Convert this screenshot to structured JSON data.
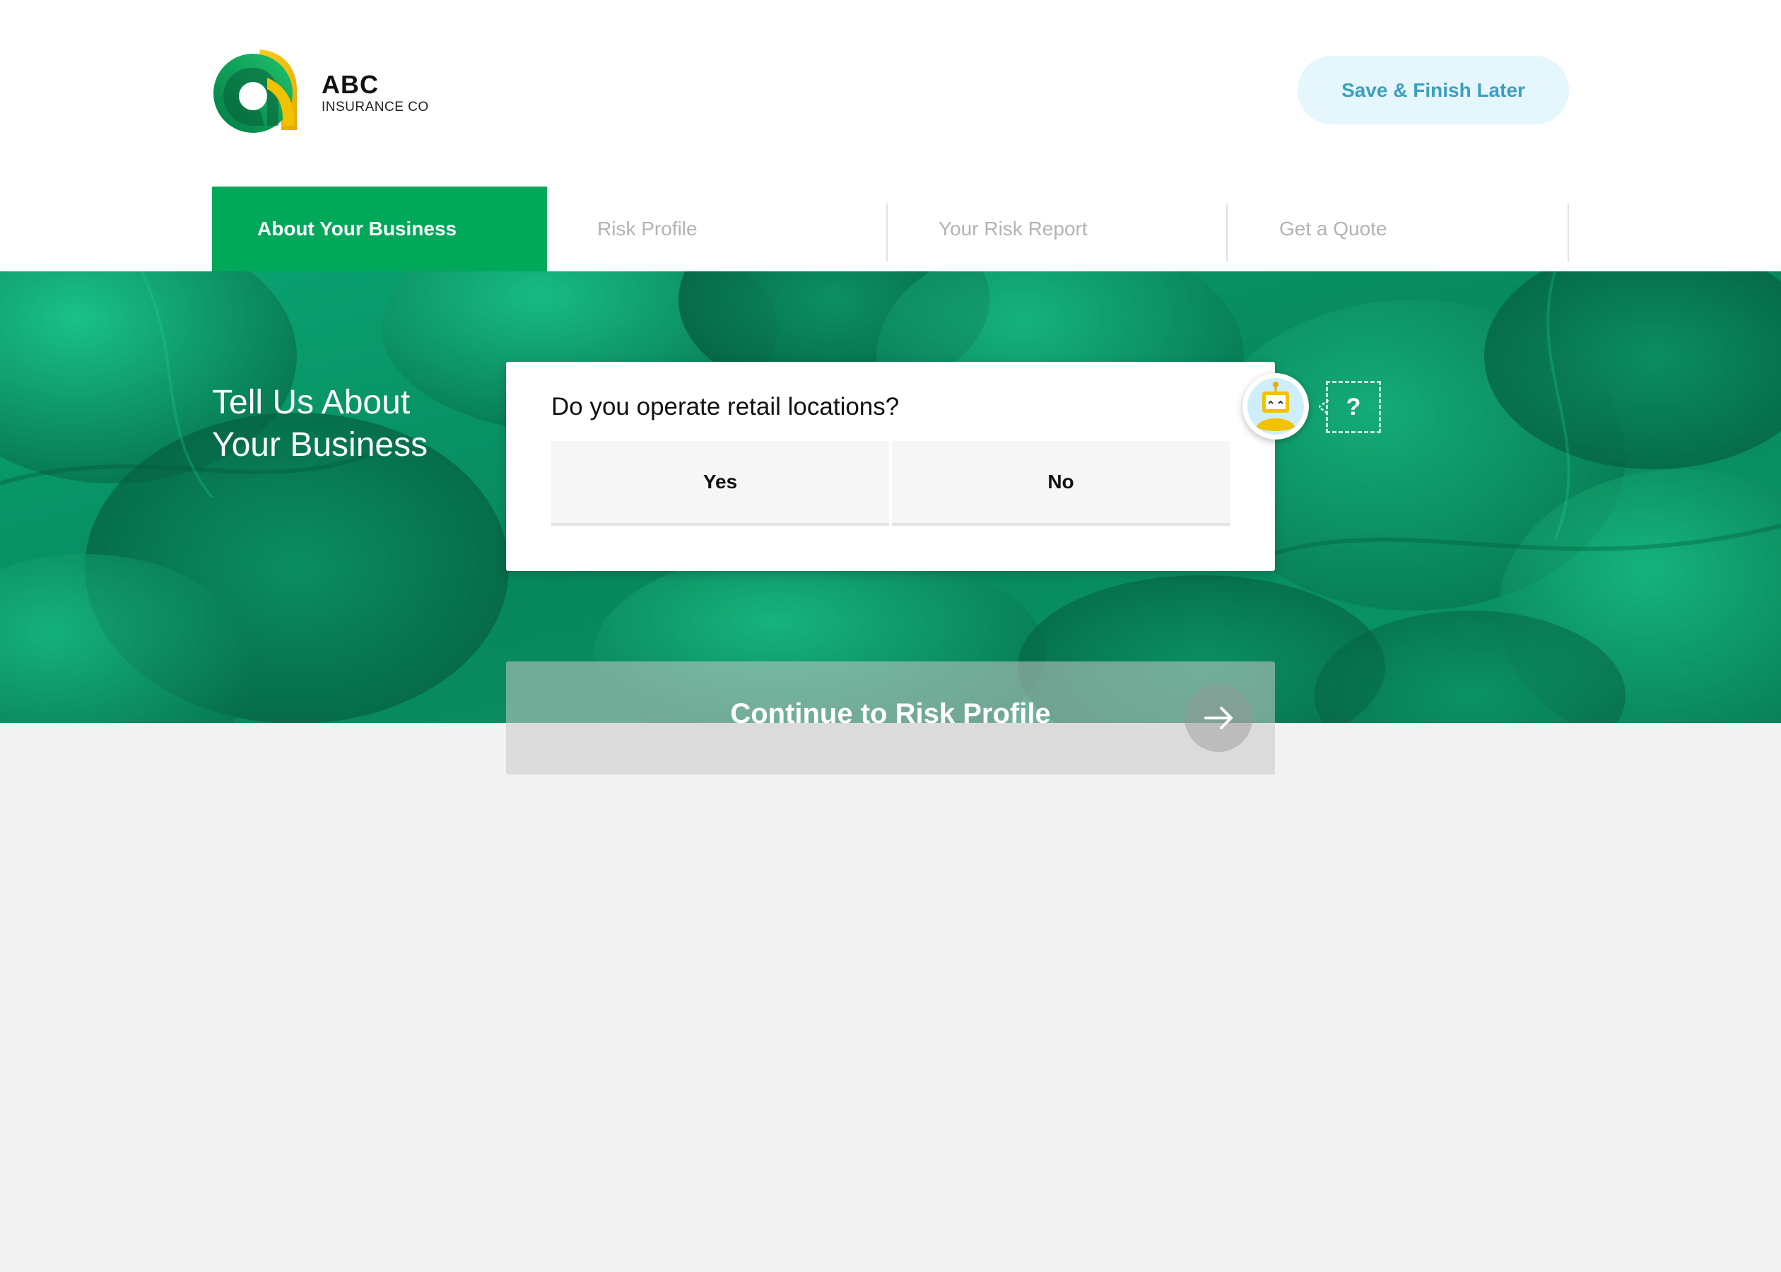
{
  "brand": {
    "name": "ABC",
    "subtitle": "INSURANCE CO"
  },
  "header": {
    "save_label": "Save & Finish Later"
  },
  "steps": [
    {
      "label": "About Your Business",
      "active": true
    },
    {
      "label": "Risk Profile",
      "active": false
    },
    {
      "label": "Your Risk Report",
      "active": false
    },
    {
      "label": "Get a Quote",
      "active": false
    }
  ],
  "hero": {
    "title_line1": "Tell Us About",
    "title_line2": "Your Business"
  },
  "question": {
    "text": "Do you operate retail locations?",
    "options": [
      "Yes",
      "No"
    ]
  },
  "help": {
    "label": "?"
  },
  "continue": {
    "label": "Continue to Risk Profile"
  },
  "icons": {
    "logo": "abc-logo-icon",
    "bot": "robot-assistant-icon",
    "arrow": "arrow-right-icon"
  },
  "colors": {
    "brand_green": "#00a85a",
    "hero_green": "#0b8a5e",
    "save_bg": "#e5f6fd",
    "save_text": "#3b9fbf",
    "page_bg": "#f2f2f2"
  }
}
